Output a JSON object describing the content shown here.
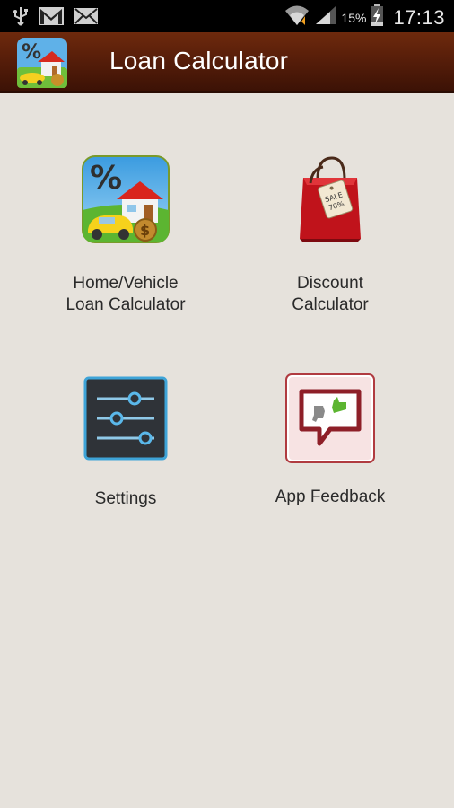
{
  "status_bar": {
    "icons": [
      "usb-icon",
      "gmail-icon",
      "email-icon",
      "wifi-icon",
      "signal-icon",
      "battery-charging-icon"
    ],
    "battery_percent": "15%",
    "time": "17:13"
  },
  "action_bar": {
    "title": "Loan Calculator",
    "app_icon": "loan-calculator-app-icon"
  },
  "menu": {
    "items": [
      {
        "label": "Home/Vehicle\nLoan Calculator",
        "icon": "home-vehicle-loan-icon"
      },
      {
        "label": "Discount\nCalculator",
        "icon": "shopping-bag-sale-icon"
      },
      {
        "label": "Settings",
        "icon": "settings-sliders-icon"
      },
      {
        "label": "App Feedback",
        "icon": "feedback-thumbs-icon"
      }
    ]
  },
  "colors": {
    "action_bar": "#5a1f0a",
    "background": "#e6e2dc",
    "status_bar": "#000000"
  }
}
